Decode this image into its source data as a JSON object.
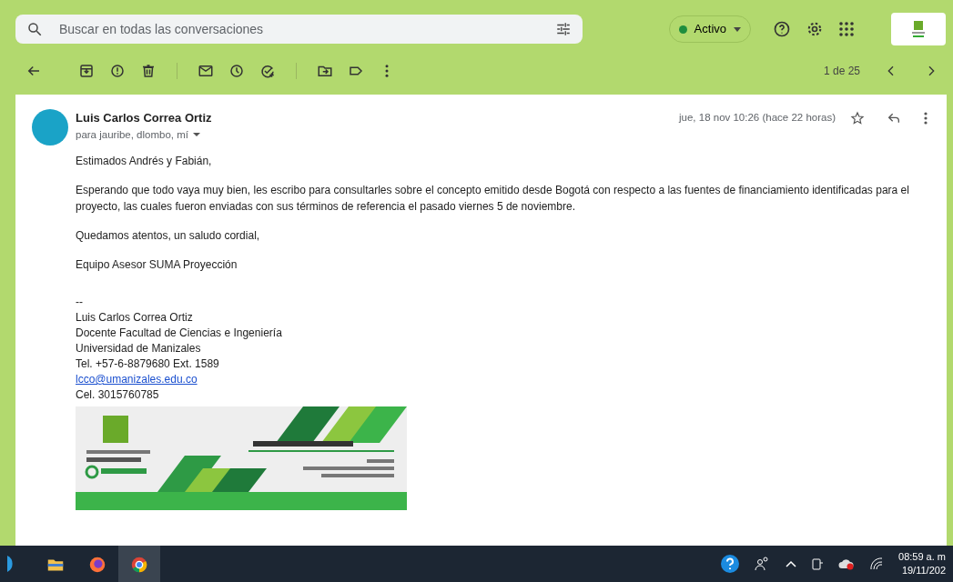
{
  "search": {
    "placeholder": "Buscar en todas las conversaciones"
  },
  "status": {
    "label": "Activo",
    "color": "#1e8e3e"
  },
  "toolbar": {
    "groups": [
      [
        {
          "kind": "back"
        }
      ],
      [
        {
          "kind": "archive"
        },
        {
          "kind": "spam"
        },
        {
          "kind": "delete"
        }
      ],
      [
        {
          "kind": "unread"
        },
        {
          "kind": "snooze"
        },
        {
          "kind": "task"
        }
      ],
      [
        {
          "kind": "move"
        },
        {
          "kind": "label"
        },
        {
          "kind": "more"
        }
      ]
    ],
    "pager": "1 de 25"
  },
  "message": {
    "sender": "Luis Carlos Correa Ortiz",
    "recipients": "para jauribe, dlombo, mí",
    "date": "jue, 18 nov 10:26 (hace 22 horas)",
    "starred": false,
    "paragraphs": [
      "Estimados Andrés y Fabián,",
      "Esperando que todo vaya muy bien, les escribo para consultarles sobre el concepto emitido desde Bogotá con respecto a las fuentes de financiamiento identificadas para el proyecto, las cuales fueron enviadas con sus términos de referencia el pasado viernes 5 de noviembre.",
      "Quedamos atentos, un saludo cordial,",
      "Equipo Asesor SUMA Proyección"
    ],
    "signature": [
      {
        "kind": "text",
        "text": "--"
      },
      {
        "kind": "text",
        "text": "Luis Carlos Correa Ortiz"
      },
      {
        "kind": "text",
        "text": "Docente Facultad de Ciencias e Ingeniería"
      },
      {
        "kind": "text",
        "text": "Universidad de Manizales"
      },
      {
        "kind": "text",
        "text": "Tel. +57-6-8879680 Ext. 1589"
      },
      {
        "kind": "link",
        "text": "lcco@umanizales.edu.co"
      },
      {
        "kind": "text",
        "text": "Cel. 3015760785"
      }
    ]
  },
  "taskbar": {
    "apps": [
      {
        "kind": "files",
        "selected": false
      },
      {
        "kind": "firefox",
        "selected": false
      },
      {
        "kind": "chrome",
        "selected": true
      }
    ],
    "time": "08:59 a. m",
    "date": "19/11/202"
  }
}
